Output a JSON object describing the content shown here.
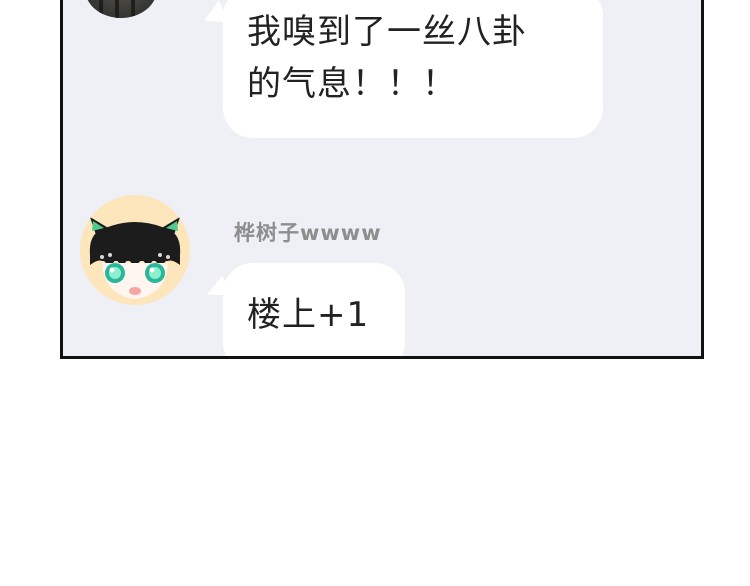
{
  "chat": {
    "messages": [
      {
        "sender": "",
        "lines": [
          "我嗅到了一丝八卦",
          "的气息！！！"
        ]
      },
      {
        "sender": "桦树子wwww",
        "lines": [
          "楼上+1"
        ]
      }
    ]
  },
  "colors": {
    "panel_background": "#eef0f5",
    "bubble_background": "#ffffff",
    "username_color": "#8e8e8e",
    "border": "#111111",
    "avatar_girl_background": "#fde6bc"
  },
  "icons": {
    "top_avatar": "dark-haired-avatar",
    "second_avatar": "cat-eared-girl-avatar"
  }
}
